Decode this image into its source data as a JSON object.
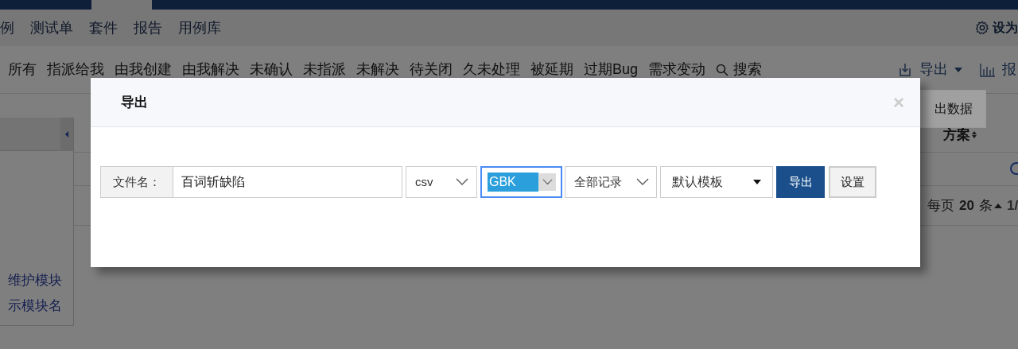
{
  "nav": {
    "items": [
      "例",
      "测试单",
      "套件",
      "报告",
      "用例库"
    ],
    "settings_link": "设为"
  },
  "filter_bar": {
    "items": [
      "所有",
      "指派给我",
      "由我创建",
      "由我解决",
      "未确认",
      "未指派",
      "未解决",
      "待关闭",
      "久未处理",
      "被延期",
      "过期Bug",
      "需求变动"
    ],
    "search": "搜索",
    "export": "导出",
    "report": "报"
  },
  "export_menu": {
    "items": [
      "出数据"
    ]
  },
  "sidebar": {
    "links": [
      "维护模块",
      "示模块名"
    ]
  },
  "table": {
    "column": "方案",
    "pager": {
      "label": "每页",
      "size": "20",
      "unit": "条",
      "page": "1/"
    }
  },
  "dialog": {
    "title": "导出",
    "close": "×",
    "filename_label": "文件名：",
    "filename": "百词斩缺陷",
    "format": "csv",
    "encoding": {
      "value": "GBK",
      "focused": true
    },
    "range": "全部记录",
    "template": "默认模板",
    "buttons": [
      {
        "label": "导出",
        "kind": "primary"
      },
      {
        "label": "设置",
        "kind": "default"
      }
    ]
  }
}
